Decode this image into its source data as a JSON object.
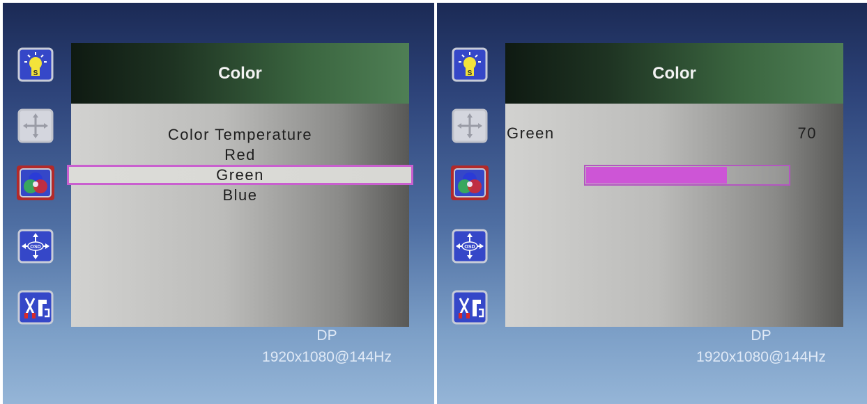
{
  "screens": [
    {
      "icons": [
        {
          "name": "brightness-icon",
          "selected": false
        },
        {
          "name": "position-icon",
          "selected": false
        },
        {
          "name": "color-icon",
          "selected": true
        },
        {
          "name": "osd-settings-icon",
          "selected": false
        },
        {
          "name": "tools-icon",
          "selected": false
        }
      ],
      "title": "Color",
      "menu_items": [
        "Color Temperature",
        "Red",
        "Green",
        "Blue"
      ],
      "selected_item": "Green",
      "input": {
        "source": "DP",
        "resolution": "1920x1080@144Hz"
      }
    },
    {
      "icons": [
        {
          "name": "brightness-icon",
          "selected": false
        },
        {
          "name": "position-icon",
          "selected": false
        },
        {
          "name": "color-icon",
          "selected": true
        },
        {
          "name": "osd-settings-icon",
          "selected": false
        },
        {
          "name": "tools-icon",
          "selected": false
        }
      ],
      "title": "Color",
      "adjust": {
        "label": "Green",
        "value": "70",
        "level": 0.7
      },
      "input": {
        "source": "DP",
        "resolution": "1920x1080@144Hz"
      }
    }
  ],
  "colors": {
    "selection_border": "#c95fcf",
    "slider_fill": "#cd55d6",
    "selected_icon_border": "#b22a2a",
    "icon_blue": "#3547c8"
  }
}
